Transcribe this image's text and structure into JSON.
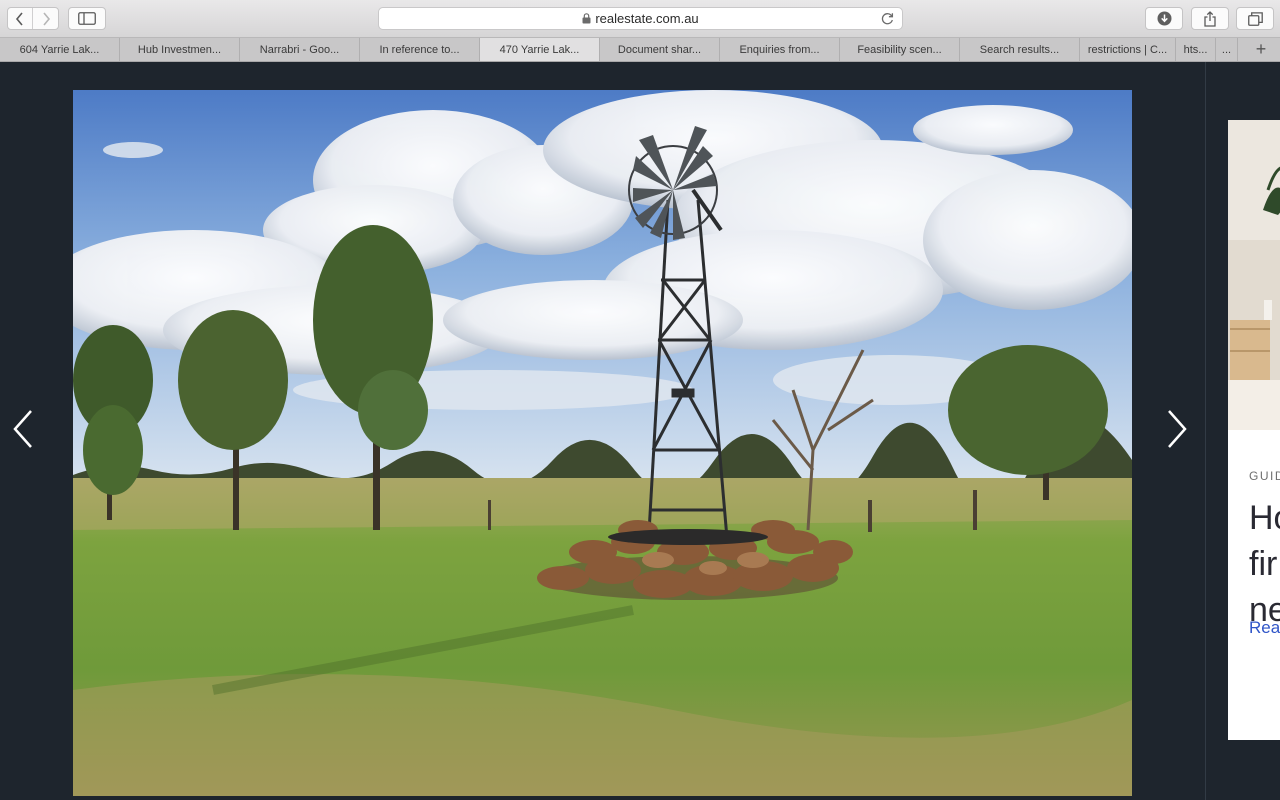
{
  "browser": {
    "address": "realestate.com.au",
    "tabs": [
      {
        "label": "604 Yarrie Lak...",
        "active": false
      },
      {
        "label": "Hub Investmen...",
        "active": false
      },
      {
        "label": "Narrabri - Goo...",
        "active": false
      },
      {
        "label": "In reference to...",
        "active": false
      },
      {
        "label": "470 Yarrie Lak...",
        "active": true
      },
      {
        "label": "Document shar...",
        "active": false
      },
      {
        "label": "Enquiries from...",
        "active": false
      },
      {
        "label": "Feasibility scen...",
        "active": false
      },
      {
        "label": "Search results...",
        "active": false
      },
      {
        "label": "restrictions | C...",
        "active": false
      },
      {
        "label": "hts...",
        "active": false
      },
      {
        "label": "...",
        "active": false
      }
    ],
    "new_tab_label": "+"
  },
  "gallery": {
    "prev_icon": "chevron-left-icon",
    "next_icon": "chevron-right-icon"
  },
  "side_card": {
    "kicker": "GUID",
    "title_lines": [
      "Ho",
      "fir",
      "ne"
    ],
    "link": "Reac"
  },
  "colors": {
    "background": "#1e252d",
    "link": "#2f55c8"
  }
}
